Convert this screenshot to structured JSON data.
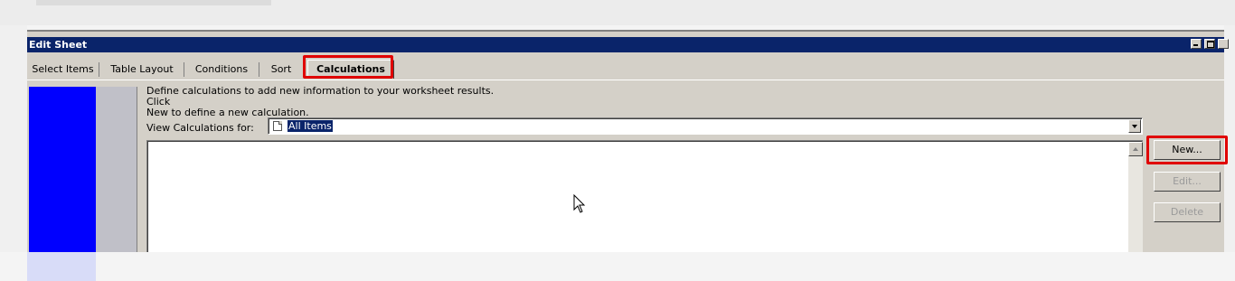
{
  "window": {
    "title": "Edit Sheet"
  },
  "tabs": [
    {
      "label": "Select Items"
    },
    {
      "label": "Table Layout"
    },
    {
      "label": "Conditions"
    },
    {
      "label": "Sort"
    },
    {
      "label": "Calculations",
      "active": true
    }
  ],
  "calculations": {
    "intro": "Define calculations to add new information to your worksheet results. Click\nNew to define a new calculation.",
    "view_label": "View Calculations for:",
    "view_value": "All Items",
    "list_items": []
  },
  "buttons": {
    "new": "New...",
    "edit": "Edit...",
    "delete": "Delete"
  },
  "colors": {
    "titlebar": "#0a246a",
    "wizard_panel": "#0000ff",
    "highlight": "#e00000",
    "dialog_face": "#d4d0c8"
  },
  "icons": {
    "view_value_icon": "document-icon",
    "cursor": "mouse-pointer-icon"
  }
}
